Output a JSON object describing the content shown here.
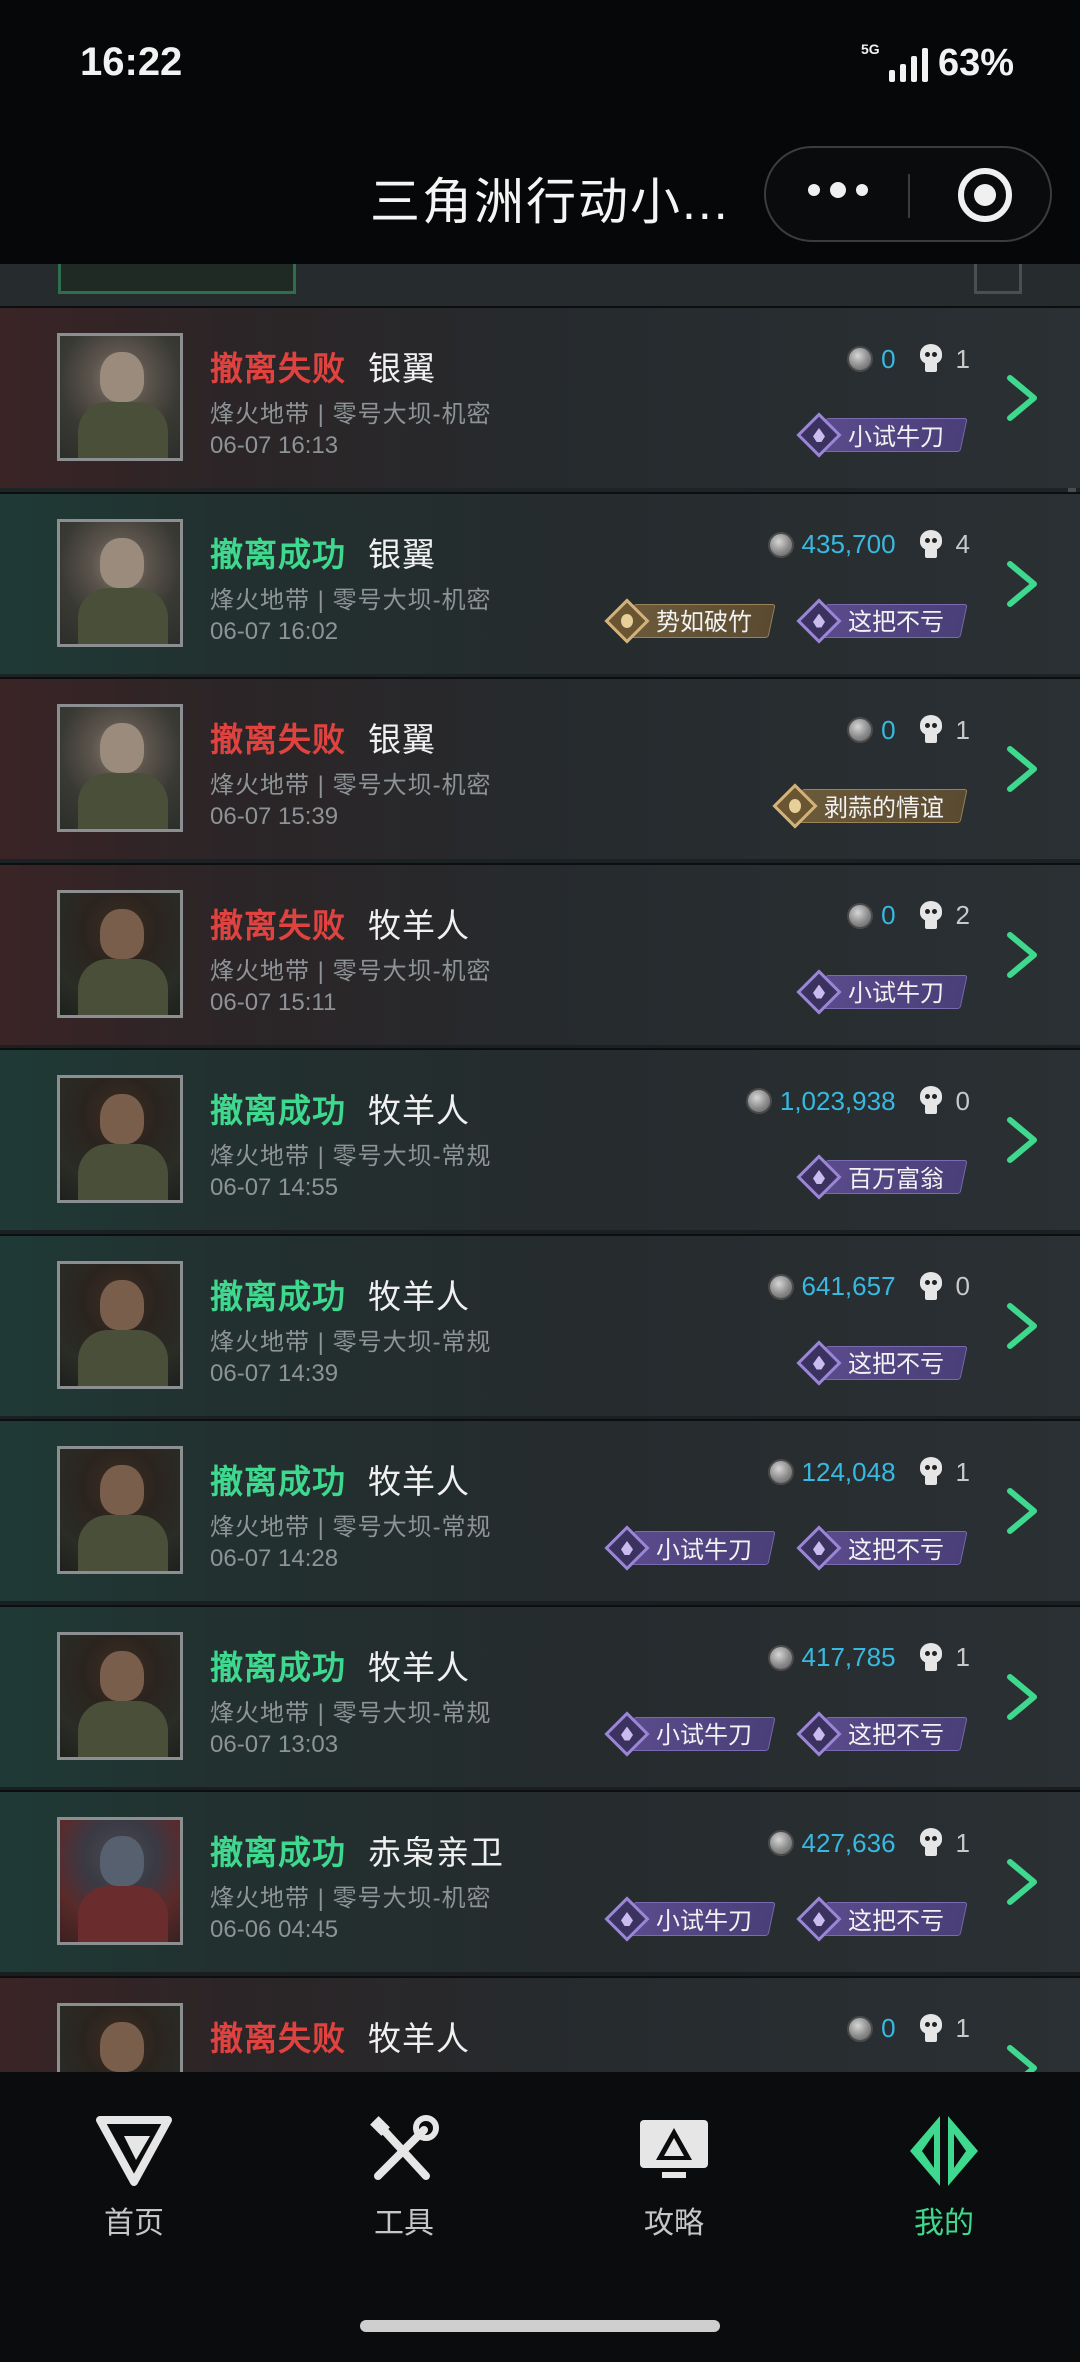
{
  "status_bar": {
    "time": "16:22",
    "network": "5G",
    "battery": "63%"
  },
  "title_bar": {
    "title": "三角洲行动小..."
  },
  "records": [
    {
      "status": "撤离失败",
      "result": "fail",
      "operator": "银翼",
      "map": "烽火地带 | 零号大坝-机密",
      "datetime": "06-07 16:13",
      "money": "0",
      "kills": "1",
      "avatar": "silver",
      "badges": [
        {
          "type": "purple",
          "label": "小试牛刀"
        }
      ]
    },
    {
      "status": "撤离成功",
      "result": "success",
      "operator": "银翼",
      "map": "烽火地带 | 零号大坝-机密",
      "datetime": "06-07 16:02",
      "money": "435,700",
      "kills": "4",
      "avatar": "silver",
      "badges": [
        {
          "type": "gold",
          "label": "势如破竹"
        },
        {
          "type": "purple",
          "label": "这把不亏"
        }
      ]
    },
    {
      "status": "撤离失败",
      "result": "fail",
      "operator": "银翼",
      "map": "烽火地带 | 零号大坝-机密",
      "datetime": "06-07 15:39",
      "money": "0",
      "kills": "1",
      "avatar": "silver",
      "badges": [
        {
          "type": "gold",
          "label": "剥蒜的情谊"
        }
      ]
    },
    {
      "status": "撤离失败",
      "result": "fail",
      "operator": "牧羊人",
      "map": "烽火地带 | 零号大坝-机密",
      "datetime": "06-07 15:11",
      "money": "0",
      "kills": "2",
      "avatar": "goat",
      "badges": [
        {
          "type": "purple",
          "label": "小试牛刀"
        }
      ]
    },
    {
      "status": "撤离成功",
      "result": "success",
      "operator": "牧羊人",
      "map": "烽火地带 | 零号大坝-常规",
      "datetime": "06-07 14:55",
      "money": "1,023,938",
      "kills": "0",
      "avatar": "goat",
      "badges": [
        {
          "type": "purple",
          "label": "百万富翁"
        }
      ]
    },
    {
      "status": "撤离成功",
      "result": "success",
      "operator": "牧羊人",
      "map": "烽火地带 | 零号大坝-常规",
      "datetime": "06-07 14:39",
      "money": "641,657",
      "kills": "0",
      "avatar": "goat",
      "badges": [
        {
          "type": "purple",
          "label": "这把不亏"
        }
      ]
    },
    {
      "status": "撤离成功",
      "result": "success",
      "operator": "牧羊人",
      "map": "烽火地带 | 零号大坝-常规",
      "datetime": "06-07 14:28",
      "money": "124,048",
      "kills": "1",
      "avatar": "goat",
      "badges": [
        {
          "type": "purple",
          "label": "小试牛刀"
        },
        {
          "type": "purple",
          "label": "这把不亏"
        }
      ]
    },
    {
      "status": "撤离成功",
      "result": "success",
      "operator": "牧羊人",
      "map": "烽火地带 | 零号大坝-常规",
      "datetime": "06-07 13:03",
      "money": "417,785",
      "kills": "1",
      "avatar": "goat",
      "badges": [
        {
          "type": "purple",
          "label": "小试牛刀"
        },
        {
          "type": "purple",
          "label": "这把不亏"
        }
      ]
    },
    {
      "status": "撤离成功",
      "result": "success",
      "operator": "赤枭亲卫",
      "map": "烽火地带 | 零号大坝-机密",
      "datetime": "06-06 04:45",
      "money": "427,636",
      "kills": "1",
      "avatar": "red",
      "badges": [
        {
          "type": "purple",
          "label": "小试牛刀"
        },
        {
          "type": "purple",
          "label": "这把不亏"
        }
      ]
    },
    {
      "status": "撤离失败",
      "result": "fail",
      "operator": "牧羊人",
      "map": "",
      "datetime": "",
      "money": "0",
      "kills": "1",
      "avatar": "goat",
      "badges": []
    }
  ],
  "bottom_nav": [
    {
      "label": "首页",
      "icon": "home-logo-icon",
      "active": false
    },
    {
      "label": "工具",
      "icon": "tools-icon",
      "active": false
    },
    {
      "label": "攻略",
      "icon": "guide-monitor-icon",
      "active": false
    },
    {
      "label": "我的",
      "icon": "profile-logo-icon",
      "active": true
    }
  ],
  "colors": {
    "success": "#3ed88e",
    "fail": "#e0433f",
    "money": "#38b9e0",
    "badge_purple": "#5a4b8c",
    "badge_gold": "#6b5a3a"
  }
}
